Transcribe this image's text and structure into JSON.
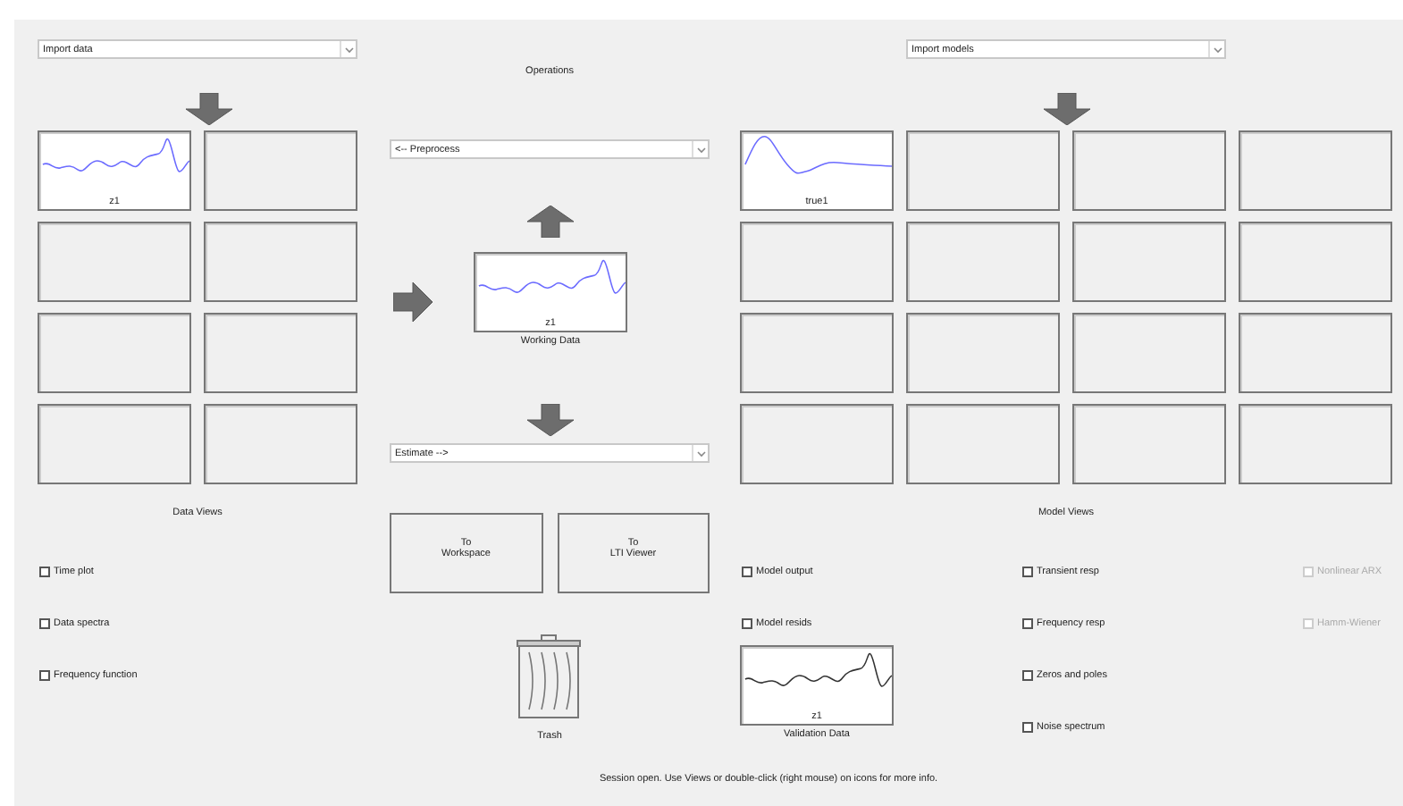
{
  "data_board": {
    "import_menu": {
      "value": "Import data"
    },
    "slots": [
      {
        "kind": "signal",
        "label": "z1"
      },
      {
        "kind": "empty"
      },
      {
        "kind": "empty"
      },
      {
        "kind": "empty"
      },
      {
        "kind": "empty"
      },
      {
        "kind": "empty"
      },
      {
        "kind": "empty"
      },
      {
        "kind": "empty"
      }
    ]
  },
  "operations": {
    "title": "Operations",
    "preprocess_menu": {
      "value": "<-- Preprocess"
    },
    "working_data": {
      "label": "z1",
      "caption": "Working Data"
    },
    "estimate_menu": {
      "value": "Estimate -->"
    },
    "buttons": [
      {
        "lines": [
          "To",
          "Workspace"
        ]
      },
      {
        "lines": [
          "To",
          "LTI Viewer"
        ]
      }
    ],
    "trash": {
      "label": "Trash"
    }
  },
  "model_board": {
    "import_menu": {
      "value": "Import models"
    },
    "slots": [
      {
        "kind": "response",
        "label": "true1"
      },
      {
        "kind": "empty"
      },
      {
        "kind": "empty"
      },
      {
        "kind": "empty"
      },
      {
        "kind": "empty"
      },
      {
        "kind": "empty"
      },
      {
        "kind": "empty"
      },
      {
        "kind": "empty"
      },
      {
        "kind": "empty"
      },
      {
        "kind": "empty"
      },
      {
        "kind": "empty"
      },
      {
        "kind": "empty"
      },
      {
        "kind": "empty"
      },
      {
        "kind": "empty"
      },
      {
        "kind": "empty"
      },
      {
        "kind": "empty"
      }
    ]
  },
  "data_views": {
    "title": "Data Views",
    "options": [
      {
        "label": "Time plot",
        "checked": false,
        "disabled": false
      },
      {
        "label": "Data spectra",
        "checked": false,
        "disabled": false
      },
      {
        "label": "Frequency function",
        "checked": false,
        "disabled": false
      }
    ]
  },
  "model_views": {
    "title": "Model Views",
    "column_1": [
      {
        "label": "Model output",
        "checked": false,
        "disabled": false
      },
      {
        "label": "Model resids",
        "checked": false,
        "disabled": false
      }
    ],
    "validation_data": {
      "label": "z1",
      "caption": "Validation Data"
    },
    "column_2": [
      {
        "label": "Transient resp",
        "checked": false,
        "disabled": false
      },
      {
        "label": "Frequency resp",
        "checked": false,
        "disabled": false
      },
      {
        "label": "Zeros and poles",
        "checked": false,
        "disabled": false
      },
      {
        "label": "Noise spectrum",
        "checked": false,
        "disabled": false
      }
    ],
    "column_3": [
      {
        "label": "Nonlinear ARX",
        "checked": false,
        "disabled": true
      },
      {
        "label": "Hamm-Wiener",
        "checked": false,
        "disabled": true
      }
    ]
  },
  "status_bar": "Session open. Use Views or double-click (right mouse) on icons for more info."
}
